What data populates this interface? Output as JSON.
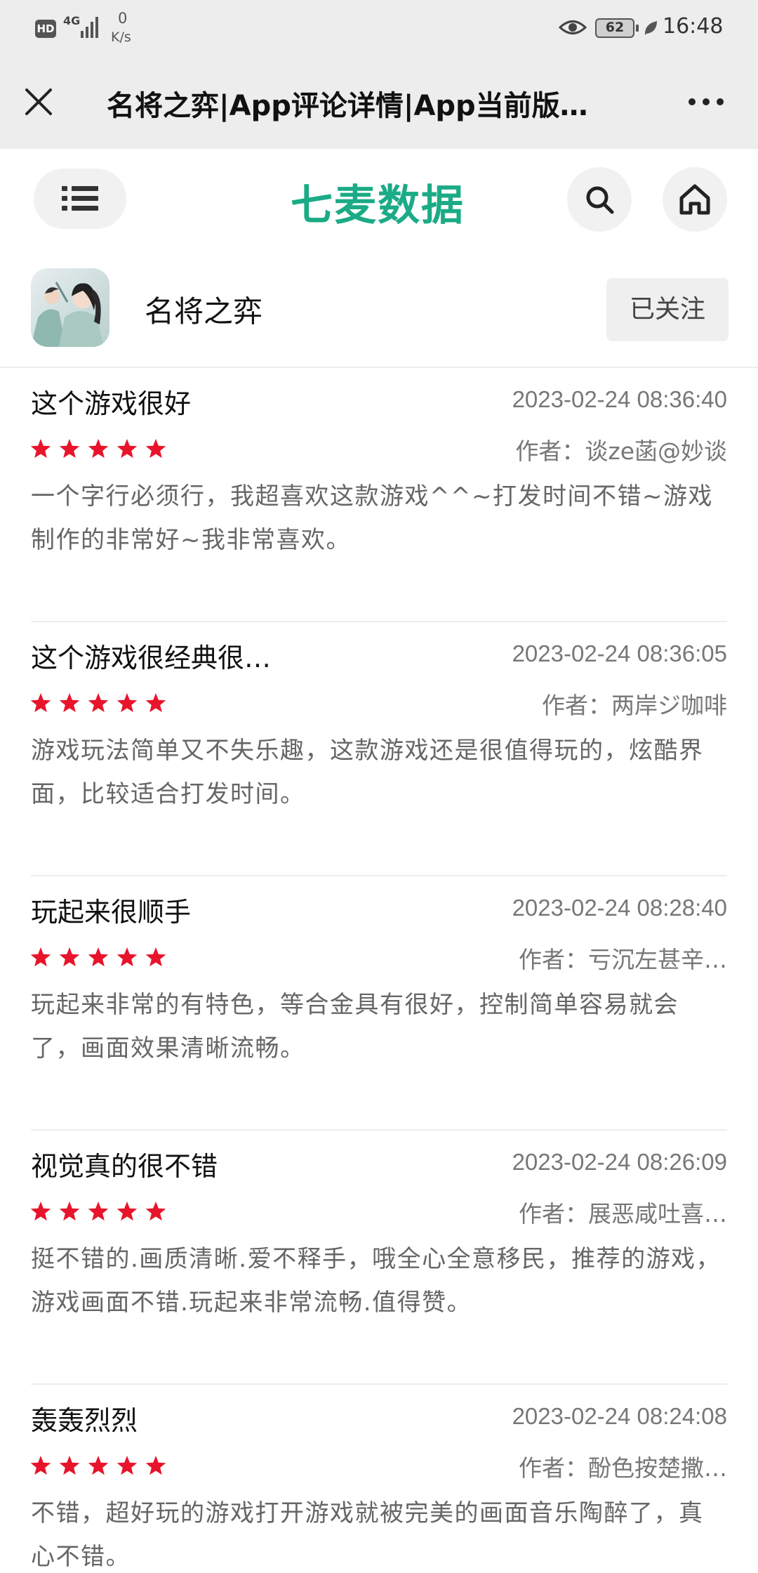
{
  "status_bar": {
    "hd": "HD",
    "network": "4G",
    "speed_value": "0",
    "speed_unit": "K/s",
    "battery": "62",
    "time": "16:48"
  },
  "title_bar": {
    "title": "名将之弈|App评论详情|App当前版…"
  },
  "site_nav": {
    "logo_text": "七麦数据",
    "brand_color": "#1bab86"
  },
  "app": {
    "name": "名将之弈",
    "follow_label": "已关注"
  },
  "reviews": [
    {
      "title": "这个游戏很好",
      "time": "2023-02-24 08:36:40",
      "stars": 5,
      "author": "作者：谈ze菡@妙谈",
      "body": "一个字行必须行，我超喜欢这款游戏^^~打发时间不错~游戏制作的非常好~我非常喜欢。"
    },
    {
      "title": "这个游戏很经典很…",
      "time": "2023-02-24 08:36:05",
      "stars": 5,
      "author": "作者：两岸ジ咖啡",
      "body": "游戏玩法简单又不失乐趣，这款游戏还是很值得玩的，炫酷界面，比较适合打发时间。"
    },
    {
      "title": "玩起来很顺手",
      "time": "2023-02-24 08:28:40",
      "stars": 5,
      "author": "作者：亏沉左甚辛…",
      "body": "玩起来非常的有特色，等合金具有很好，控制简单容易就会了，画面效果清晰流畅。"
    },
    {
      "title": "视觉真的很不错",
      "time": "2023-02-24 08:26:09",
      "stars": 5,
      "author": "作者：展恶咸吐喜…",
      "body": "挺不错的.画质清晰.爱不释手，哦全心全意移民，推荐的游戏，游戏画面不错.玩起来非常流畅.值得赞。"
    },
    {
      "title": "轰轰烈烈",
      "time": "2023-02-24 08:24:08",
      "stars": 5,
      "author": "作者：酚色按楚撒…",
      "body": "不错，超好玩的游戏打开游戏就被完美的画面音乐陶醉了，真心不错。"
    }
  ],
  "colors": {
    "star": "#e8142b",
    "status_bg": "#ededed"
  }
}
